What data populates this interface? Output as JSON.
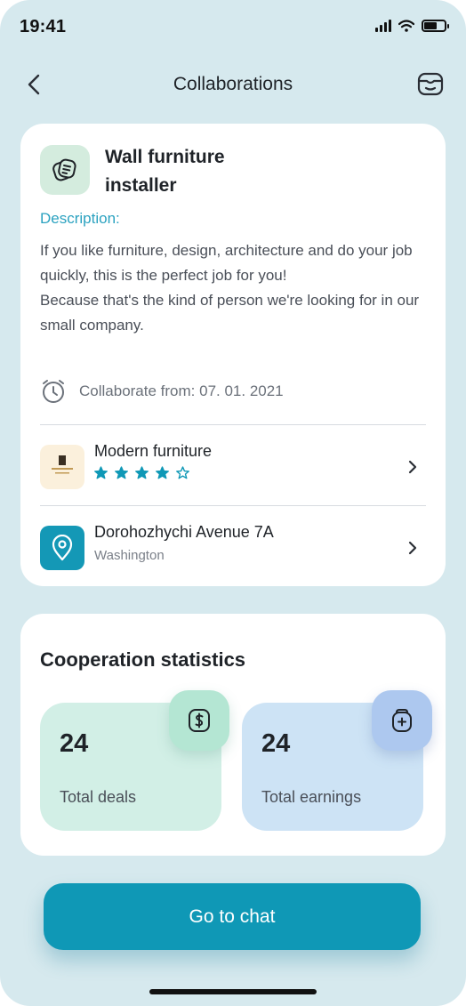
{
  "status_bar": {
    "time": "19:41"
  },
  "nav": {
    "title": "Collaborations"
  },
  "job": {
    "title": "Wall furniture installer",
    "description_label": "Description:",
    "description": "If you like furniture, design, architecture and do your job quickly, this is the perfect job for you!\nBecause that's the kind of person we're looking for in our small company.",
    "collaborate_from": "Collaborate from: 07. 01. 2021"
  },
  "company": {
    "name": "Modern furniture",
    "rating": 4,
    "rating_max": 5
  },
  "location": {
    "address": "Dorohozhychi Avenue 7A",
    "city": "Washington"
  },
  "stats": {
    "title": "Cooperation statistics",
    "deals": {
      "value": "24",
      "label": "Total deals"
    },
    "earnings": {
      "value": "24",
      "label": "Total earnings"
    }
  },
  "cta": {
    "label": "Go to chat"
  },
  "colors": {
    "accent": "#0f98b6",
    "background": "#d6e9ee",
    "deals_card": "#d2efe6",
    "earnings_card": "#cde3f5"
  },
  "icons": [
    "back-chevron-icon",
    "profile-box-icon",
    "job-cards-icon",
    "clock-icon",
    "star-icon",
    "location-pin-icon",
    "chevron-right-icon",
    "dollar-icon",
    "wallet-plus-icon"
  ]
}
